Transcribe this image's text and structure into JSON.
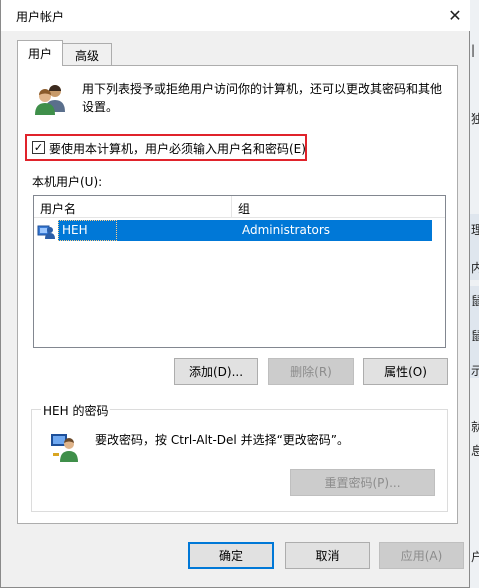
{
  "window": {
    "title": "用户帐户",
    "close_glyph": "✕"
  },
  "tabs": [
    {
      "label": "用户",
      "selected": true
    },
    {
      "label": "高级",
      "selected": false
    }
  ],
  "intro": {
    "text": "用下列表授予或拒绝用户访问你的计算机，还可以更改其密码和其他设置。",
    "icon": "users-icon"
  },
  "require_password": {
    "label": "要使用本计算机，用户必须输入用户名和密码(E)",
    "checked": true,
    "check_glyph": "✓",
    "highlight_color": "#e0232b"
  },
  "local_users": {
    "label": "本机用户(U):",
    "columns": [
      "用户名",
      "组"
    ],
    "rows": [
      {
        "name": "HEH",
        "group": "Administrators",
        "selected": true
      }
    ],
    "selection_color": "#0078d7"
  },
  "user_buttons": {
    "add": "添加(D)...",
    "remove": "删除(R)",
    "remove_disabled": true,
    "properties": "属性(O)"
  },
  "password_group": {
    "title": "HEH 的密码",
    "text": "要改密码，按 Ctrl-Alt-Del 并选择“更改密码”。",
    "reset_button": "重置密码(P)...",
    "reset_disabled": true,
    "icon": "user-key-icon"
  },
  "footer": {
    "ok": "确定",
    "cancel": "取消",
    "apply": "应用(A)",
    "apply_disabled": true
  },
  "background": {
    "fragments": [
      "|",
      "独",
      "理",
      "内",
      "鼠",
      "鼠",
      "示",
      "就",
      "息",
      "户"
    ]
  }
}
